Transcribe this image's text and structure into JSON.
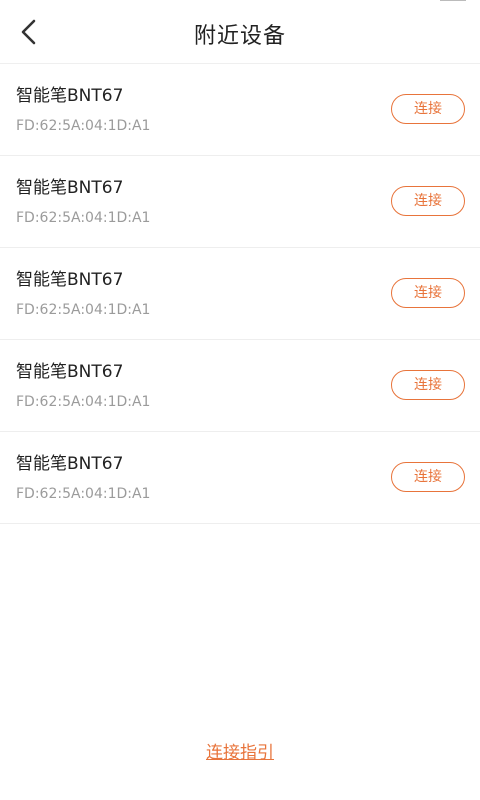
{
  "header": {
    "title": "附近设备",
    "back_icon": "chevron-left-icon"
  },
  "colors": {
    "accent": "#e8743b",
    "primary_text": "#222222",
    "secondary_text": "#9b9b9b",
    "divider": "#eeeeee"
  },
  "devices": [
    {
      "name": "智能笔BNT67",
      "mac": "FD:62:5A:04:1D:A1",
      "button_label": "连接"
    },
    {
      "name": "智能笔BNT67",
      "mac": "FD:62:5A:04:1D:A1",
      "button_label": "连接"
    },
    {
      "name": "智能笔BNT67",
      "mac": "FD:62:5A:04:1D:A1",
      "button_label": "连接"
    },
    {
      "name": "智能笔BNT67",
      "mac": "FD:62:5A:04:1D:A1",
      "button_label": "连接"
    },
    {
      "name": "智能笔BNT67",
      "mac": "FD:62:5A:04:1D:A1",
      "button_label": "连接"
    }
  ],
  "footer": {
    "guide_link": "连接指引"
  }
}
